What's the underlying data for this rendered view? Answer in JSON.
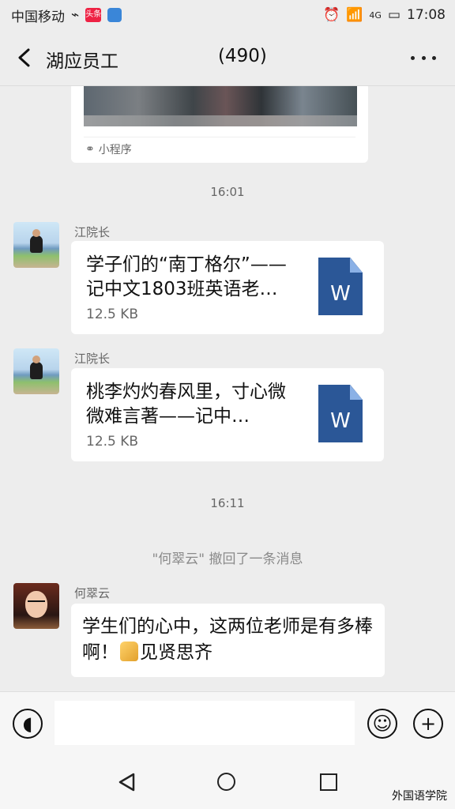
{
  "status": {
    "carrier": "中国移动",
    "badge_text": "头条",
    "network": "4G",
    "time": "17:08"
  },
  "header": {
    "title": "湖应员工",
    "member_count": "(490)"
  },
  "messages": [
    {
      "type": "miniapp",
      "source": "小程序"
    },
    {
      "type": "time",
      "text": "16:01"
    },
    {
      "type": "file",
      "sender": "江院长",
      "filename": "学子们的“南丁格尔”——记中文1803班英语老…",
      "size": "12.5 KB",
      "icon": "W"
    },
    {
      "type": "file",
      "sender": "江院长",
      "filename": "桃李灼灼春风里，寸心微微难言著——记中…",
      "size": "12.5 KB",
      "icon": "W"
    },
    {
      "type": "time",
      "text": "16:11"
    },
    {
      "type": "system",
      "text": "\"何翠云\" 撤回了一条消息"
    },
    {
      "type": "text",
      "sender": "何翠云",
      "text_before": "学生们的心中，这两位老师是有多棒啊！",
      "text_after": "见贤思齐"
    }
  ],
  "watermark": "外国语学院",
  "colors": {
    "background": "#ededed",
    "bubble": "#ffffff",
    "file_icon": "#2b5797"
  },
  "icons": {
    "back": "chevron-left-icon",
    "more": "more-icon",
    "voice": "voice-icon",
    "emoji": "emoji-icon",
    "plus": "plus-icon",
    "file": "word-document-icon",
    "thumb": "thumbs-up-icon"
  }
}
